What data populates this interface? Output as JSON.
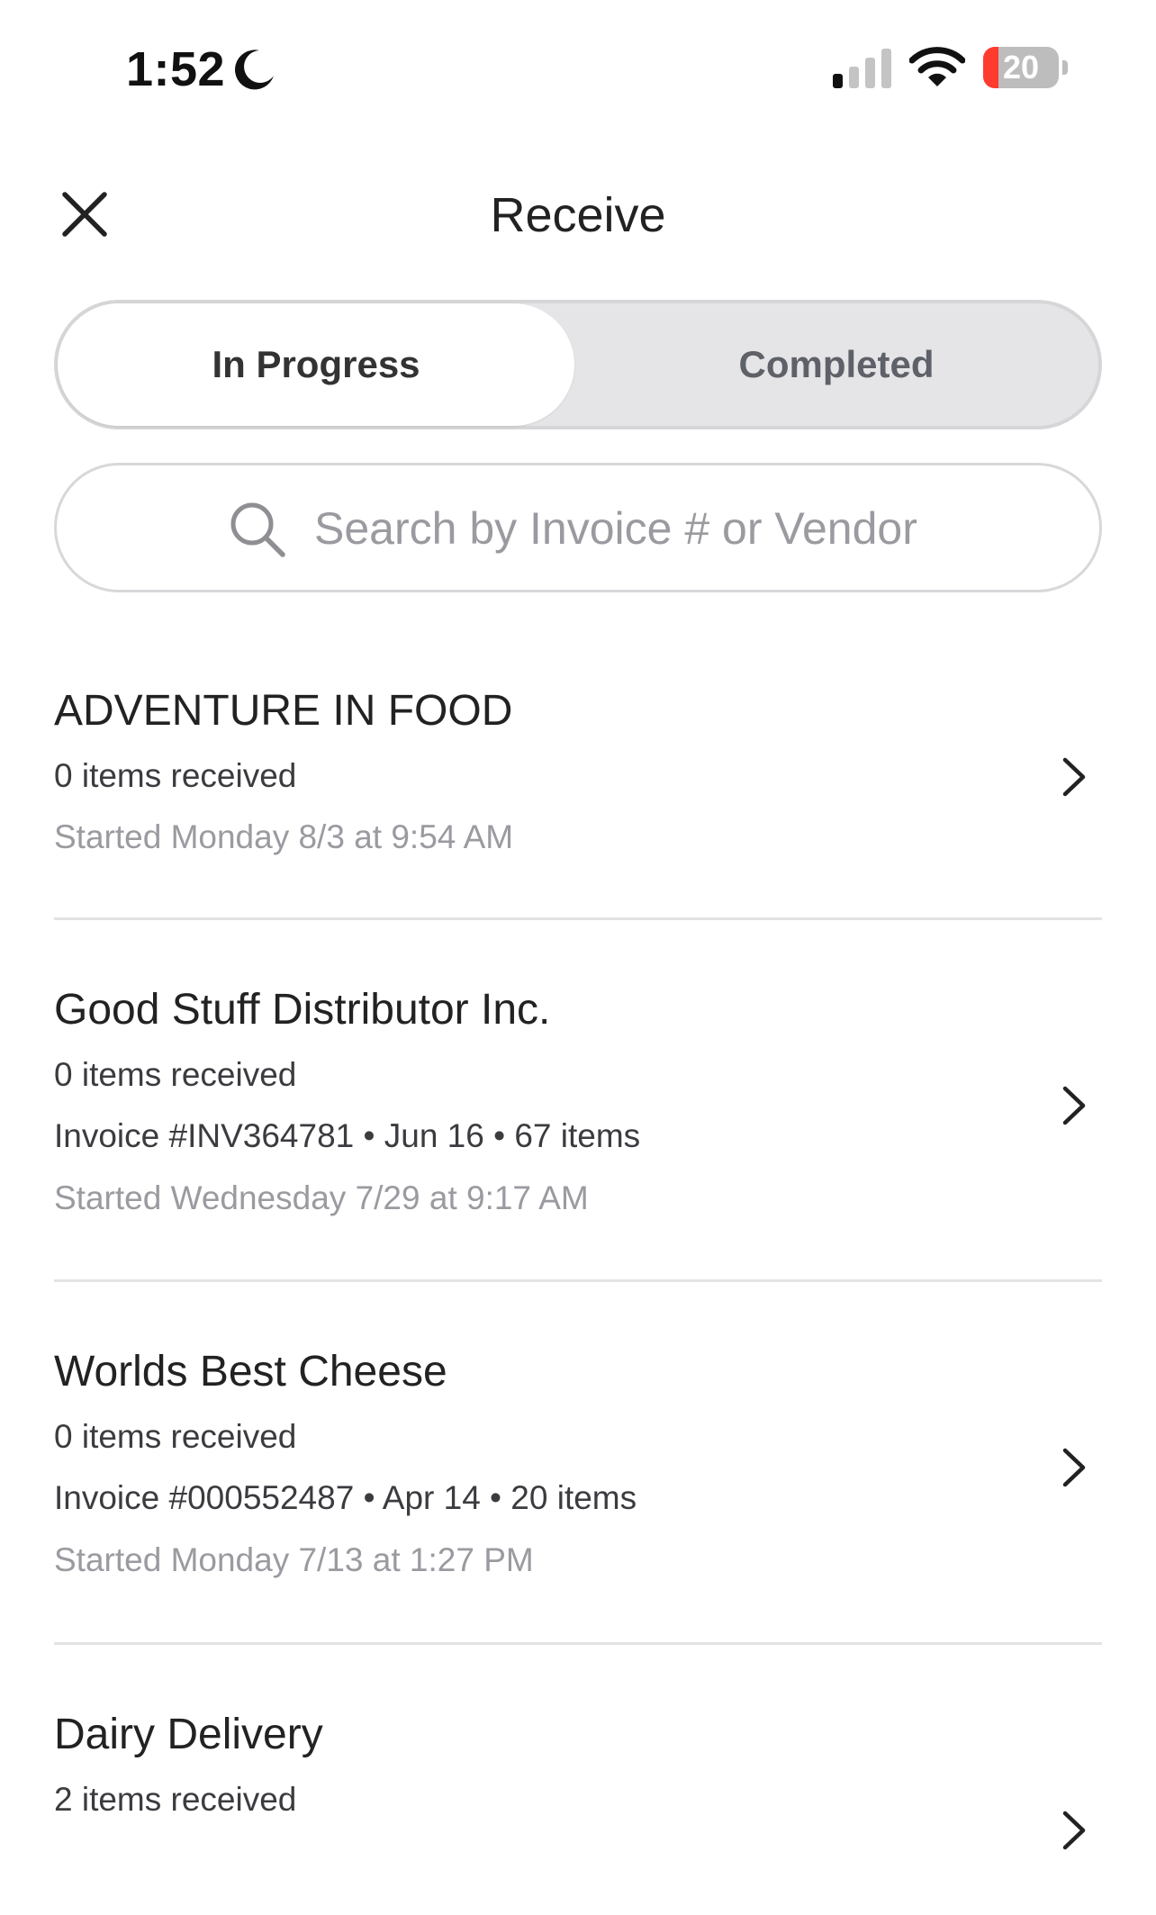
{
  "status_bar": {
    "time": "1:52",
    "battery_level": "20",
    "battery_fraction": 0.2,
    "icons": [
      "moon-icon",
      "cellular-signal-icon",
      "wifi-icon",
      "battery-icon"
    ]
  },
  "header": {
    "title": "Receive",
    "close_icon": "close-icon"
  },
  "tabs": {
    "in_progress": "In Progress",
    "completed": "Completed",
    "selected": "In Progress"
  },
  "search": {
    "placeholder": "Search by Invoice # or Vendor",
    "value": ""
  },
  "receivings": [
    {
      "vendor": "ADVENTURE IN FOOD",
      "received": "0 items received",
      "started": "Started Monday 8/3 at 9:54 AM"
    },
    {
      "vendor": "Good Stuff Distributor Inc.",
      "received": "0 items received",
      "invoice": "Invoice #INV364781 • Jun 16 • 67 items",
      "started": "Started Wednesday 7/29 at 9:17 AM"
    },
    {
      "vendor": "Worlds Best Cheese",
      "received": "0 items received",
      "invoice": "Invoice #000552487 • Apr 14 • 20 items",
      "started": "Started Monday 7/13 at 1:27 PM"
    },
    {
      "vendor": "Dairy Delivery",
      "received": "2 items received"
    }
  ],
  "colors": {
    "text_primary": "#222222",
    "text_muted": "#9a9aa0",
    "segment_bg": "#e5e5e8",
    "battery_low": "#ff3b30"
  }
}
